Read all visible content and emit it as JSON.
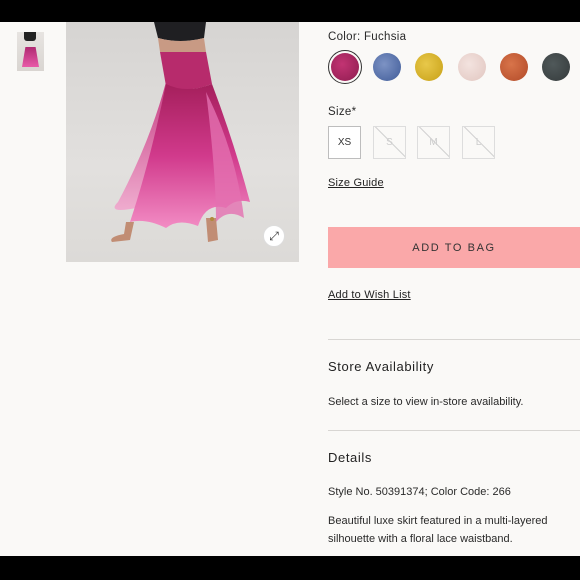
{
  "color": {
    "label": "Color: Fuchsia",
    "swatches": [
      {
        "name": "fuchsia",
        "hex": "#a8245e",
        "selected": true
      },
      {
        "name": "blue",
        "hex": "#4e6aa8"
      },
      {
        "name": "yellow",
        "hex": "#d9b424"
      },
      {
        "name": "blush",
        "hex": "#ecd6d2"
      },
      {
        "name": "rust",
        "hex": "#c55a32"
      },
      {
        "name": "charcoal",
        "hex": "#3e4546"
      }
    ]
  },
  "size": {
    "label": "Size*",
    "options": [
      {
        "label": "XS",
        "available": true
      },
      {
        "label": "S",
        "available": false
      },
      {
        "label": "M",
        "available": false
      },
      {
        "label": "L",
        "available": false
      }
    ],
    "guide_link": "Size Guide"
  },
  "actions": {
    "add_to_bag": "ADD TO BAG",
    "wish_list": "Add to Wish List"
  },
  "store": {
    "title": "Store Availability",
    "text": "Select a size to view in-store availability."
  },
  "details": {
    "title": "Details",
    "style_line": "Style No. 50391374; Color Code: 266",
    "description": "Beautiful luxe skirt featured in a multi-layered silhouette with a floral lace waistband."
  },
  "icons": {
    "expand": "expand-icon"
  },
  "colors": {
    "accent": "#faa8a9",
    "background": "#faf9f7"
  }
}
